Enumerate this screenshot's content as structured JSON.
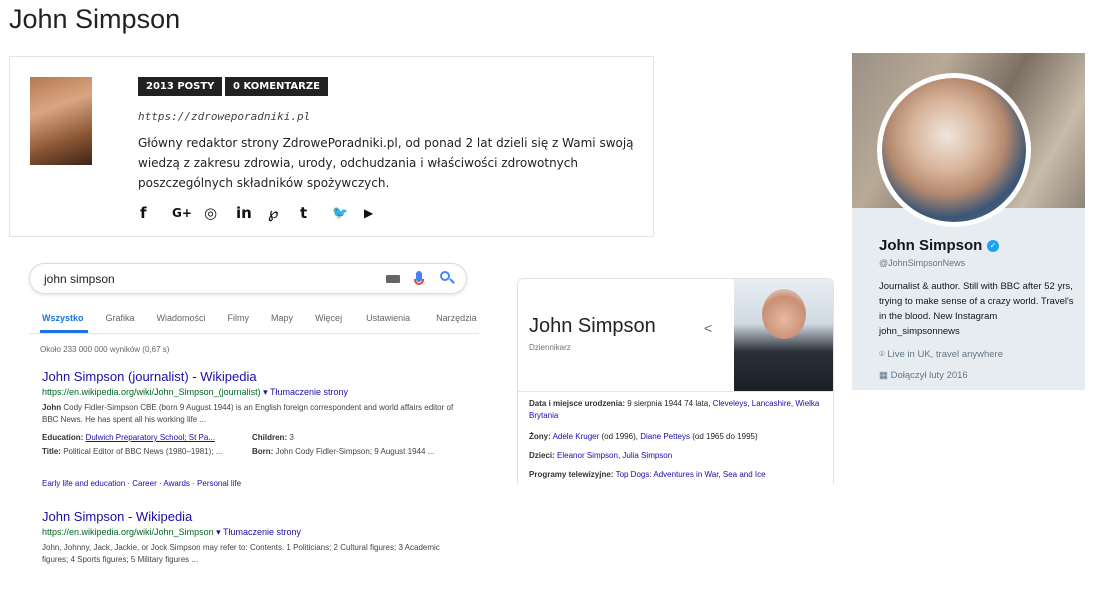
{
  "page": {
    "title": "John Simpson"
  },
  "author_box": {
    "posts_badge": "2013 POSTY",
    "comments_badge": "0 KOMENTARZE",
    "url": "https://zdroweporadniki.pl",
    "bio": "Główny redaktor strony ZdrowePoradniki.pl, od ponad 2 lat dzieli się z Wami swoją wiedzą z zakresu zdrowia, urody, odchudzania i właściwości zdrowotnych poszczególnych składników spożywczych.",
    "social": [
      {
        "name": "facebook-icon",
        "glyph": "f"
      },
      {
        "name": "google-plus-icon",
        "glyph": "G+"
      },
      {
        "name": "instagram-icon",
        "glyph": "◎"
      },
      {
        "name": "linkedin-icon",
        "glyph": "in"
      },
      {
        "name": "pinterest-icon",
        "glyph": "℘"
      },
      {
        "name": "tumblr-icon",
        "glyph": "t"
      },
      {
        "name": "twitter-icon",
        "glyph": "🐦"
      },
      {
        "name": "youtube-icon",
        "glyph": "▶"
      }
    ]
  },
  "google": {
    "query": "john simpson",
    "tabs": [
      "Wszystko",
      "Grafika",
      "Wiadomości",
      "Filmy",
      "Mapy",
      "Więcej",
      "Ustawienia",
      "Narzędzia"
    ],
    "active_tab": "Wszystko",
    "stats": "Około 233 000 000 wyników (0,67 s)",
    "results": [
      {
        "title": "John Simpson (journalist) - Wikipedia",
        "url": "https://en.wikipedia.org/wiki/John_Simpson_(journalist)",
        "translate": "▾ Tłumaczenie strony",
        "snippet_bold": "John",
        "snippet": "Cody Fidler-Simpson CBE (born 9 August 1944) is an English foreign correspondent and world affairs editor of BBC News. He has spent all his working life ...",
        "facts": {
          "education_label": "Education:",
          "education_value": "Dulwich Preparatory School; St Pa...",
          "children_label": "Children:",
          "children_value": "3",
          "title_label": "Title:",
          "title_value": "Political Editor of BBC News (1980–1981); ...",
          "born_label": "Born:",
          "born_value": "John Cody Fidler-Simpson; 9 August 1944 ..."
        },
        "sublinks": "Early life and education · Career · Awards · Personal life"
      },
      {
        "title": "John Simpson - Wikipedia",
        "url": "https://en.wikipedia.org/wiki/John_Simpson",
        "translate": "▾ Tłumaczenie strony",
        "snippet": "John, Johnny, Jack, Jackie, or Jock Simpson may refer to: Contents. 1 Politicians; 2 Cultural figures; 3 Academic figures; 4 Sports figures; 5 Military figures ..."
      }
    ]
  },
  "knowledge_panel": {
    "name": "John Simpson",
    "subtitle": "Dziennikarz",
    "born_label": "Data i miejsce urodzenia:",
    "born_value": "9 sierpnia 1944 74 lata,",
    "born_place": "Cleveleys, Lancashire, Wielka Brytania",
    "spouses_label": "Żony:",
    "spouse1": "Adele Kruger",
    "spouse1_years": "(od 1996),",
    "spouse2": "Diane Petteys",
    "spouse2_years": "(od 1965 do 1995)",
    "children_label": "Dzieci:",
    "children_value": "Eleanor Simpson, Julia Simpson",
    "tv_label": "Programy telewizyjne:",
    "tv_value": "Top Dogs: Adventures in War, Sea and Ice"
  },
  "twitter": {
    "name": "John Simpson",
    "handle": "@JohnSimpsonNews",
    "bio": "Journalist & author. Still with BBC after 52 yrs, trying to make sense of a crazy world. Travel's in the blood. New Instagram john_simpsonnews",
    "location": "Live in UK, travel anywhere",
    "joined": "Dołączył luty 2016",
    "verified_glyph": "✓",
    "location_glyph": "⌾",
    "calendar_glyph": "▦"
  }
}
